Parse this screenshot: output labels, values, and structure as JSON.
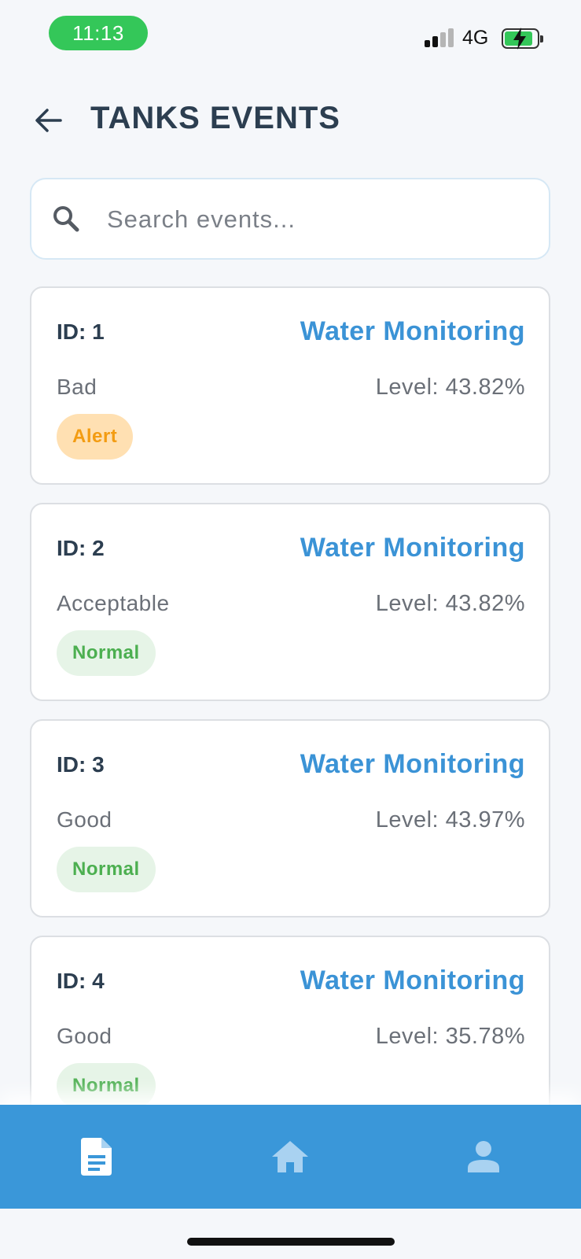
{
  "status_bar": {
    "time": "11:13",
    "network": "4G"
  },
  "header": {
    "title": "TANKS EVENTS"
  },
  "search": {
    "placeholder": "Search events..."
  },
  "events": [
    {
      "id": "ID: 1",
      "title": "Water Monitoring",
      "status": "Bad",
      "level": "Level: 43.82%",
      "badge": "Alert",
      "badge_type": "alert"
    },
    {
      "id": "ID: 2",
      "title": "Water Monitoring",
      "status": "Acceptable",
      "level": "Level: 43.82%",
      "badge": "Normal",
      "badge_type": "normal"
    },
    {
      "id": "ID: 3",
      "title": "Water Monitoring",
      "status": "Good",
      "level": "Level: 43.97%",
      "badge": "Normal",
      "badge_type": "normal"
    },
    {
      "id": "ID: 4",
      "title": "Water Monitoring",
      "status": "Good",
      "level": "Level: 35.78%",
      "badge": "Normal",
      "badge_type": "normal"
    }
  ],
  "colors": {
    "accent": "#3a97d9",
    "alert_bg": "#ffe0b2",
    "alert_text": "#f39c12",
    "normal_bg": "#e6f4e7",
    "normal_text": "#4caf50",
    "nav_active": "#ffffff",
    "nav_inactive": "#a9d2f1"
  },
  "bottom_nav": [
    {
      "icon": "document-icon",
      "active": true
    },
    {
      "icon": "home-icon",
      "active": false
    },
    {
      "icon": "user-icon",
      "active": false
    }
  ]
}
